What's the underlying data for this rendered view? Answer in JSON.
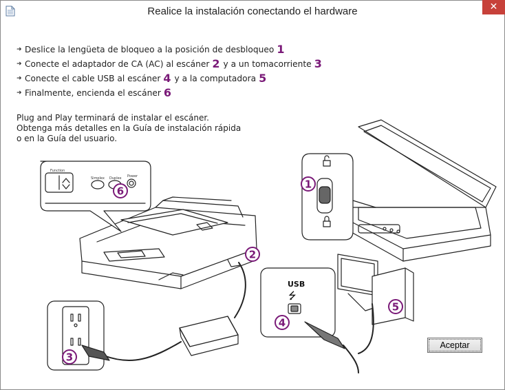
{
  "window": {
    "title": "Realice la instalación conectando el hardware",
    "close_glyph": "✕",
    "title_icon": "document-icon"
  },
  "steps": [
    {
      "text": "Deslice la lengüeta de bloqueo a la posición de desbloqueo",
      "num1": "1",
      "text2": "",
      "num2": ""
    },
    {
      "text": "Conecte el adaptador de CA (AC) al escáner",
      "num1": "2",
      "text2": "y a un tomacorriente",
      "num2": "3"
    },
    {
      "text": "Conecte el cable USB al escáner",
      "num1": "4",
      "text2": "y a la computadora",
      "num2": "5"
    },
    {
      "text": "Finalmente, encienda el escáner",
      "num1": "6",
      "text2": "",
      "num2": ""
    }
  ],
  "bullet": "➜",
  "info": {
    "line1": "Plug and Play terminará de instalar el escáner.",
    "line2": "Obtenga más detalles en la Guía de instalación rápida",
    "line3": "o en la Guía del usuario."
  },
  "illustration": {
    "callouts": [
      "1",
      "2",
      "3",
      "4",
      "5",
      "6"
    ],
    "panel_labels": {
      "function": "Function",
      "simplex": "Simplex",
      "duplex": "Duplex",
      "power": "Power"
    },
    "usb_label": "USB",
    "usb_symbol": "⭍"
  },
  "buttons": {
    "accept": "Aceptar"
  },
  "colors": {
    "accent": "#7a1a78",
    "close": "#c7413a"
  }
}
